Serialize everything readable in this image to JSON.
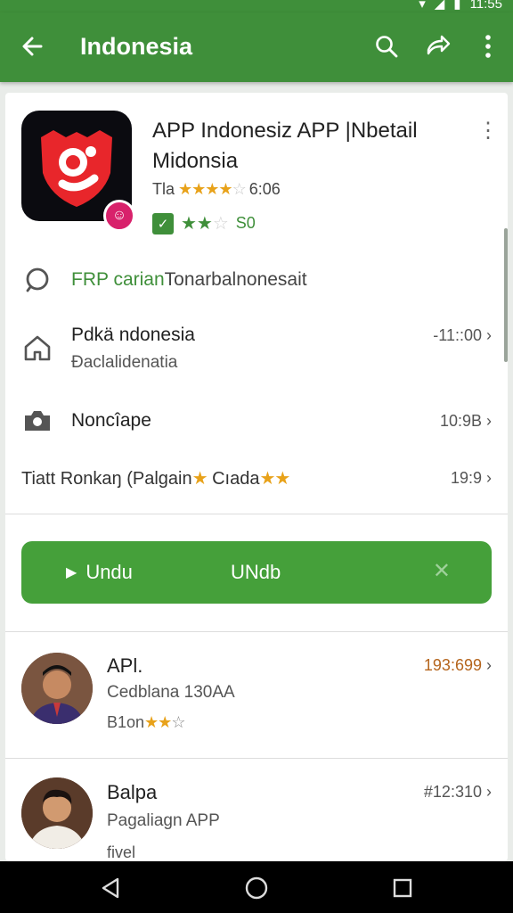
{
  "status_bar": {
    "time": "11:55"
  },
  "appbar": {
    "title": "Indonesia"
  },
  "app": {
    "title": "APP Indonesiz APP |Nbetail Midonsia",
    "rating_prefix": "Tla",
    "rating_value": "6:06",
    "rating_count": "S0"
  },
  "rows": [
    {
      "icon": "search-icon",
      "label_green": "FRP carian",
      "label_rest": "Tonarbalnonesait"
    },
    {
      "icon": "home-icon",
      "primary": "Pdkä ndonesia",
      "secondary": "Đaclalidenatia",
      "meta": "-11::00"
    },
    {
      "icon": "camera-icon",
      "primary": "Noncîape",
      "meta": "10:9B"
    },
    {
      "primary_a": "Tiatt Ronkaŋ (Palgain",
      "primary_b": "Cıada",
      "meta": "19:9"
    }
  ],
  "install": {
    "left_label": "Undu",
    "center_label": "UNdb"
  },
  "reviews": [
    {
      "name": "APl.",
      "subtitle": "Cedblana 130AA",
      "rating_prefix": "B1on",
      "meta": "193:699"
    },
    {
      "name": "Balpa",
      "subtitle": "Pagaliagn APP",
      "rating_prefix": "fivel",
      "meta": "#12:310"
    }
  ],
  "colors": {
    "primary": "#3f8f3a",
    "button": "#45a03a",
    "accent_star": "#e8a21a",
    "meta_orange": "#b5651d"
  }
}
